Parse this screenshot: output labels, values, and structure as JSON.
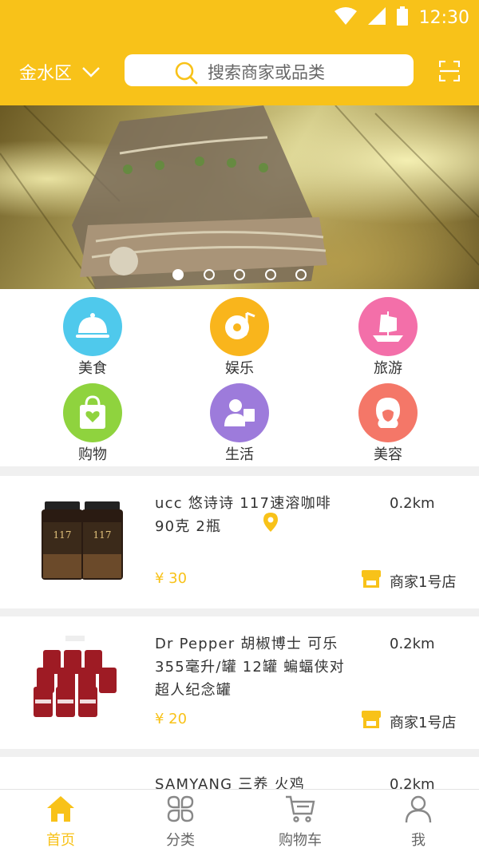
{
  "status_bar": {
    "time": "12:30"
  },
  "header": {
    "city": "金水区",
    "search_placeholder": "搜索商家或品类"
  },
  "banner": {
    "slide_count": 5,
    "active_index": 0
  },
  "categories": [
    {
      "label": "美食",
      "icon": "food-cloche-icon",
      "color": "#4fc9ec"
    },
    {
      "label": "娱乐",
      "icon": "music-disc-icon",
      "color": "#f9b51c"
    },
    {
      "label": "旅游",
      "icon": "sailboat-icon",
      "color": "#f36fa9"
    },
    {
      "label": "购物",
      "icon": "shopping-bag-icon",
      "color": "#8fd33e"
    },
    {
      "label": "生活",
      "icon": "person-service-icon",
      "color": "#9d7bdb"
    },
    {
      "label": "美容",
      "icon": "beauty-face-icon",
      "color": "#f47768"
    }
  ],
  "products": [
    {
      "title": "ucc 悠诗诗 117速溶咖啡 90克 2瓶",
      "distance": "0.2km",
      "price": "¥ 30",
      "shop": "商家1号店"
    },
    {
      "title": "Dr Pepper 胡椒博士 可乐 355毫升/罐 12罐 蝙蝠侠对超人纪念罐",
      "distance": "0.2km",
      "price": "¥ 20",
      "shop": "商家1号店"
    },
    {
      "title": "SAMYANG 三养 火鸡",
      "distance": "0.2km"
    }
  ],
  "tabbar": [
    {
      "label": "首页",
      "icon": "home-icon"
    },
    {
      "label": "分类",
      "icon": "category-icon"
    },
    {
      "label": "购物车",
      "icon": "cart-icon"
    },
    {
      "label": "我",
      "icon": "user-icon"
    }
  ],
  "colors": {
    "accent": "#f8c219"
  }
}
